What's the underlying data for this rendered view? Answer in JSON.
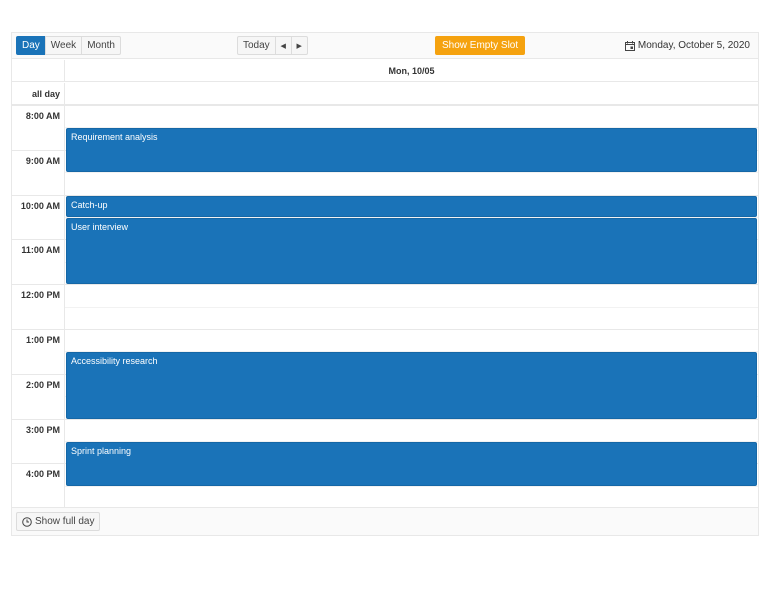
{
  "toolbar": {
    "views": [
      {
        "label": "Day",
        "active": true
      },
      {
        "label": "Week",
        "active": false
      },
      {
        "label": "Month",
        "active": false
      }
    ],
    "today_label": "Today",
    "prev_icon": "caret-left-icon",
    "next_icon": "caret-right-icon",
    "show_empty_slot_label": "Show Empty Slot",
    "date_label": "Monday, October 5, 2020",
    "date_icon": "calendar-icon"
  },
  "header": {
    "day_label": "Mon, 10/05"
  },
  "allday": {
    "label": "all day"
  },
  "time_slots": [
    "8:00 AM",
    "9:00 AM",
    "10:00 AM",
    "11:00 AM",
    "12:00 PM",
    "1:00 PM",
    "2:00 PM",
    "3:00 PM",
    "4:00 PM"
  ],
  "events": [
    {
      "title": "Requirement analysis",
      "start": "8:30 AM",
      "end": "9:30 AM"
    },
    {
      "title": "Catch-up",
      "start": "10:00 AM",
      "end": "10:30 AM"
    },
    {
      "title": "User interview",
      "start": "10:30 AM",
      "end": "12:00 PM"
    },
    {
      "title": "Accessibility research",
      "start": "1:30 PM",
      "end": "3:00 PM"
    },
    {
      "title": "Sprint planning",
      "start": "3:30 PM",
      "end": "4:30 PM"
    }
  ],
  "colors": {
    "primary": "#1a73b8",
    "accent": "#f5a20f"
  },
  "footer": {
    "show_full_day_label": "Show full day",
    "icon": "clock-icon"
  }
}
